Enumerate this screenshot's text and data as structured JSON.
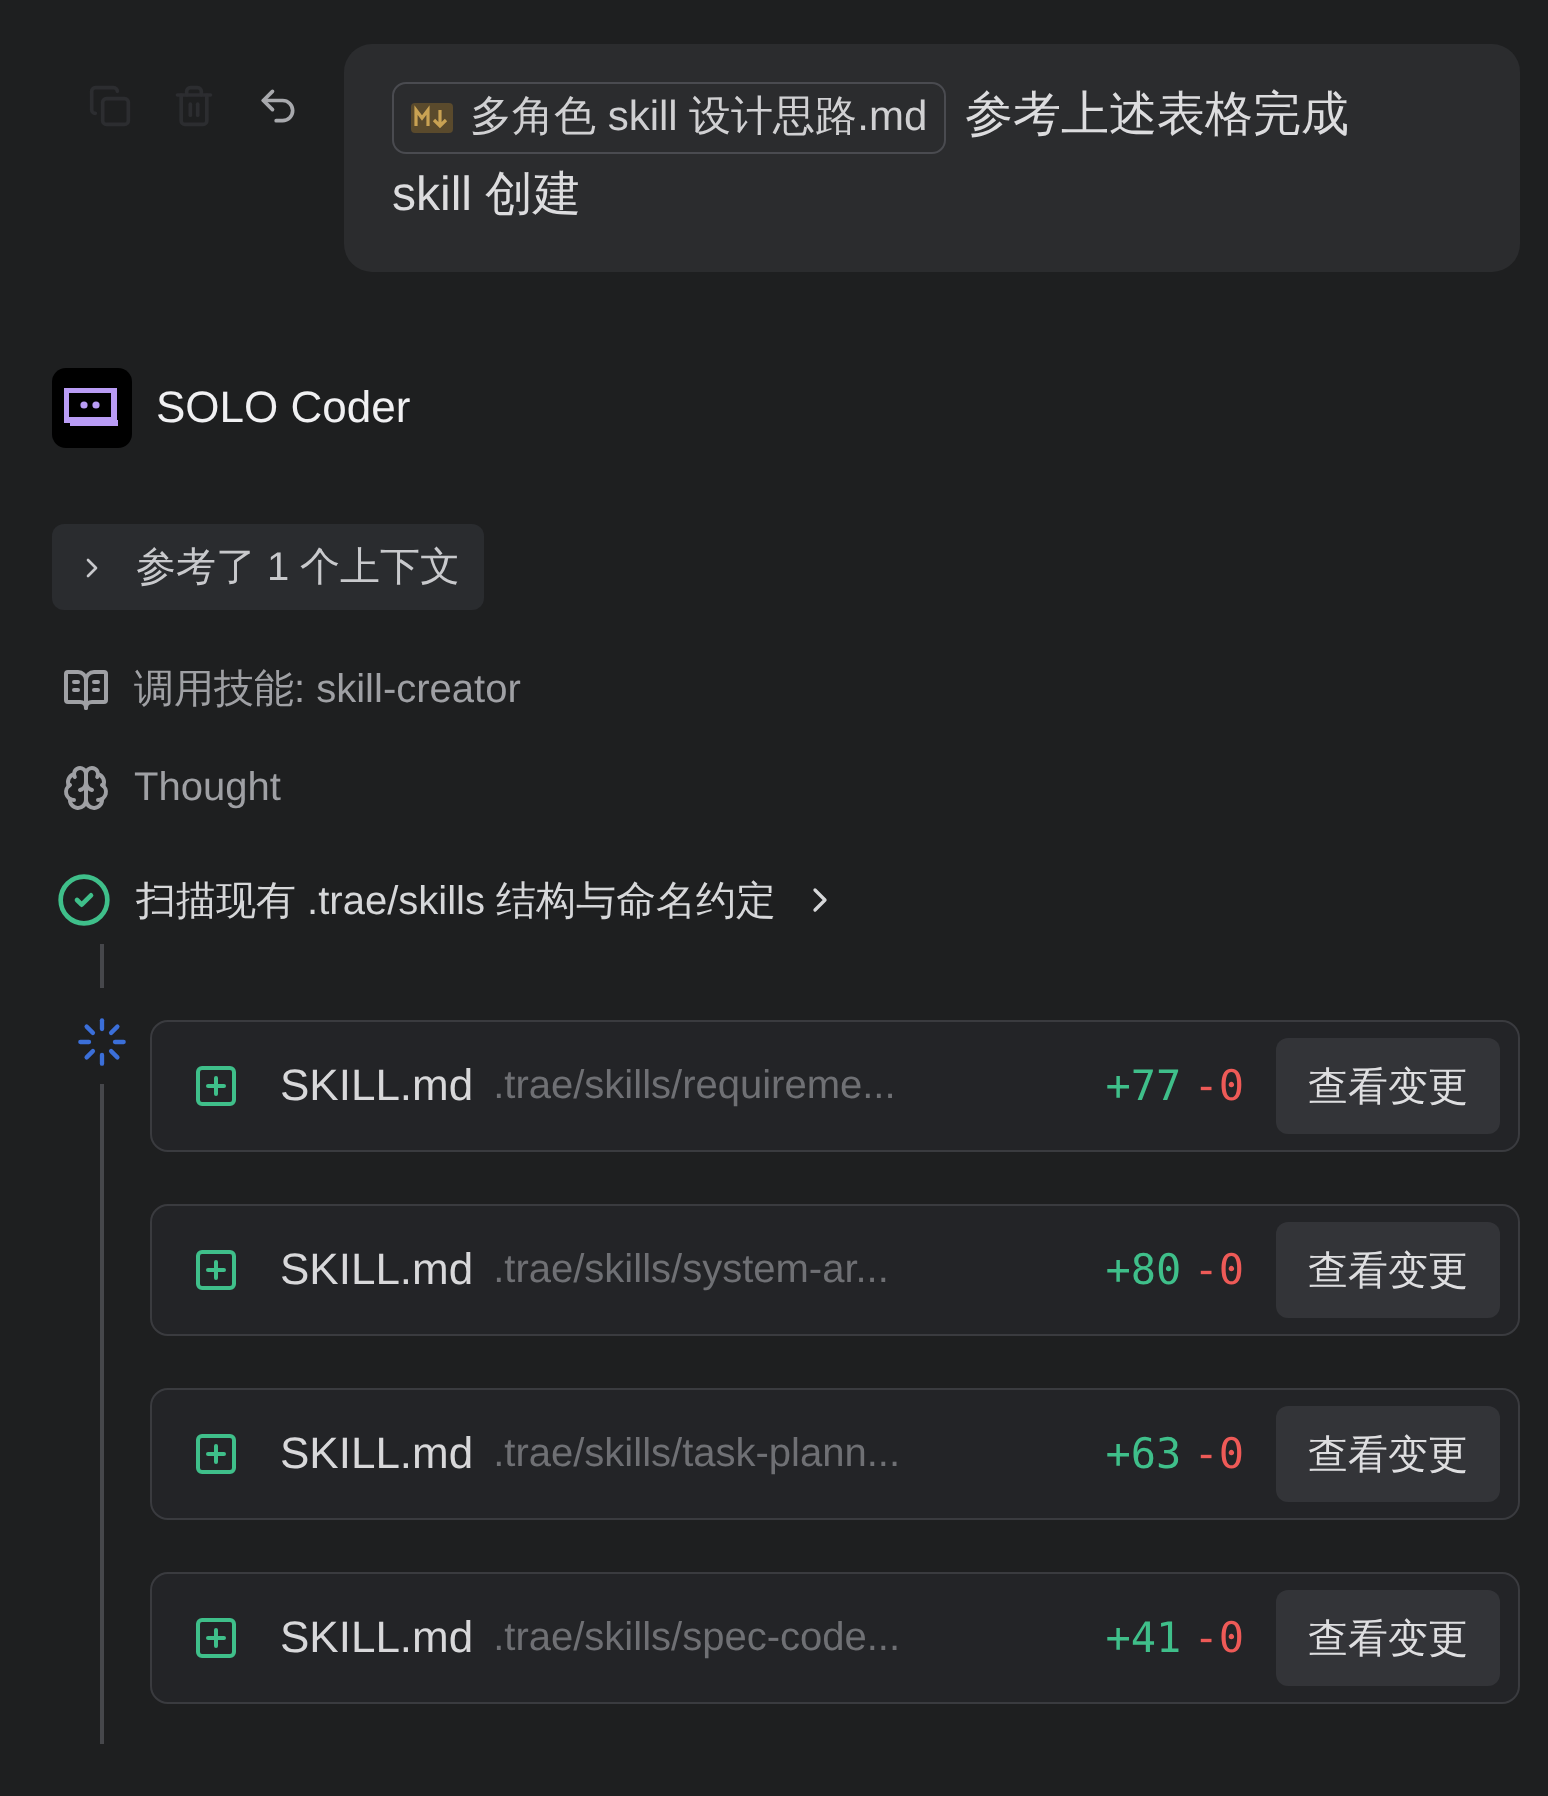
{
  "message": {
    "attachment": "多角色 skill 设计思路.md",
    "lines": [
      "参考上述表格完成",
      "skill 创建"
    ]
  },
  "agent": {
    "name": "SOLO Coder"
  },
  "context": {
    "label": "参考了 1 个上下文",
    "expanded": false
  },
  "steps": [
    {
      "kind": "skill",
      "text": "调用技能: skill-creator"
    },
    {
      "kind": "thought",
      "text": "Thought"
    }
  ],
  "task": {
    "title": "扫描现有 .trae/skills 结构与命名约定",
    "done": true
  },
  "files": [
    {
      "name": "SKILL.md",
      "path": ".trae/skills/requireme...",
      "added": "+77",
      "removed": "-0",
      "button": "查看变更"
    },
    {
      "name": "SKILL.md",
      "path": ".trae/skills/system-ar...",
      "added": "+80",
      "removed": "-0",
      "button": "查看变更"
    },
    {
      "name": "SKILL.md",
      "path": ".trae/skills/task-plann...",
      "added": "+63",
      "removed": "-0",
      "button": "查看变更"
    },
    {
      "name": "SKILL.md",
      "path": ".trae/skills/spec-code...",
      "added": "+41",
      "removed": "-0",
      "button": "查看变更"
    }
  ]
}
